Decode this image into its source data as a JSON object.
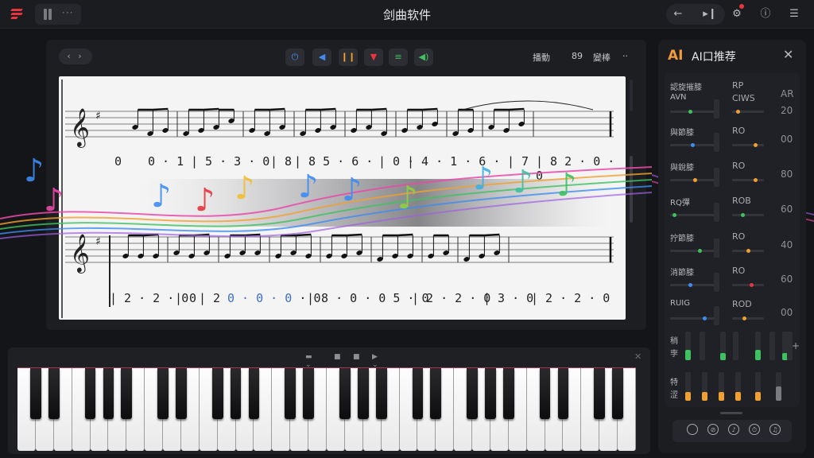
{
  "app": {
    "title": "剑曲软件"
  },
  "titlebar": {
    "more": "···",
    "icons": [
      "back-arrow-icon",
      "waveform-icon",
      "settings-gear-icon",
      "info-icon",
      "mixer-icon"
    ]
  },
  "score_toolbar": {
    "nav": "‹ ›",
    "buttons": [
      {
        "name": "power-icon",
        "glyph": "⏻",
        "color": "#3f8cf0"
      },
      {
        "name": "skip-back-icon",
        "glyph": "◀",
        "color": "#3f8cf0"
      },
      {
        "name": "pause-icon",
        "glyph": "❙❙",
        "color": "#f0a030"
      },
      {
        "name": "record-icon",
        "glyph": "▼",
        "color": "#e8353f"
      },
      {
        "name": "list-icon",
        "glyph": "≡",
        "color": "#3fc060"
      },
      {
        "name": "speaker-icon",
        "glyph": "◀)",
        "color": "#3fc060"
      }
    ],
    "label_mode": "播動",
    "label_bpm": "89",
    "label_key": "變棒",
    "label_more": "··"
  },
  "score": {
    "row1_numbers": [
      "0",
      "0 · 1",
      "| 5 · 3 · 0",
      "| 8",
      "| 8  5 · 6 ·",
      "| 0 ·",
      "| 4 · 1 · 6 ·",
      "| 7",
      "| 8  2 · 0 · 0"
    ],
    "row2_numbers": [
      "| 2 · 2 · 0",
      "| 0",
      "| 2 0 · 0 · 0 · 0",
      "| 8 · 0 · 0 5 · 0",
      "| 2 · 2 · 0",
      "| 3 · 0",
      "| 2 · 2 · 0"
    ],
    "row2_highlight": "0 · 0 · 0"
  },
  "piano": {
    "tools": [
      "▬ ⌄",
      "■",
      "■",
      "▶ ⌄",
      "✕"
    ],
    "white_keys": 34,
    "black_key_pattern": [
      1,
      1,
      0,
      1,
      1,
      1,
      0
    ]
  },
  "ai_panel": {
    "badge": "AI",
    "title": "AI口推荐",
    "close": "✕",
    "rows": [
      {
        "label": "認旋摧膝",
        "sub": "AVN",
        "mid": "RP",
        "mid_sub": "CIWS",
        "num": "AR",
        "num2": "20",
        "dot1": "#3fc060",
        "dot2": "#f0a030",
        "pos1": 0.4,
        "pos2": 0.15
      },
      {
        "label": "與節膝",
        "mid": "RO",
        "num": "00",
        "dot1": "#3f8cf0",
        "dot2": "#f0a030",
        "pos1": 0.45,
        "pos2": 0.75
      },
      {
        "label": "與銳膝",
        "mid": "RO",
        "num": "80",
        "dot1": "#f0a030",
        "dot2": "#f0a030",
        "pos1": 0.5,
        "pos2": 0.75
      },
      {
        "label": "RQ彈",
        "mid": "ROB",
        "num": "60",
        "dot1": "#3fc060",
        "dot2": "#3fc060",
        "pos1": 0.05,
        "pos2": 0.3
      },
      {
        "label": "拧節膝",
        "mid": "RO",
        "num": "40",
        "dot1": "#3fc060",
        "dot2": "#f0a030",
        "pos1": 0.6,
        "pos2": 0.5
      },
      {
        "label": "消節膝",
        "mid": "RO",
        "num": "60",
        "dot1": "#3f8cf0",
        "dot2": "#e8353f",
        "pos1": 0.4,
        "pos2": 0.6
      },
      {
        "label": "RUIG",
        "mid": "ROD",
        "num": "00",
        "dot1": "#3f8cf0",
        "dot2": "#f0a030",
        "pos1": 0.7,
        "pos2": 0.35
      }
    ],
    "fader_labels": [
      "稍",
      "孛",
      "特",
      "涩"
    ],
    "fader_levels_top": [
      0.35,
      0,
      0.25,
      0,
      0.35,
      0,
      0.25,
      0
    ],
    "fader_levels_bottom": [
      0.3,
      0.3,
      0.3,
      0.3,
      0.3,
      0.5
    ],
    "plus": "+",
    "bottom_icons": [
      "circle-icon",
      "compass-icon",
      "tuning-icon",
      "metronome-icon",
      "export-icon"
    ]
  }
}
